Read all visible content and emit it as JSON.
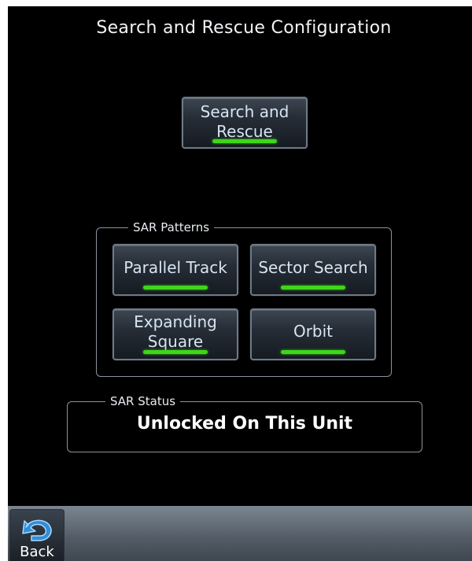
{
  "page": {
    "title": "Search and Rescue Configuration"
  },
  "sar_toggle": {
    "label": "Search and\nRescue",
    "enabled": true
  },
  "patterns": {
    "group_label": "SAR Patterns",
    "items": [
      {
        "label": "Parallel Track",
        "enabled": true
      },
      {
        "label": "Sector Search",
        "enabled": true
      },
      {
        "label": "Expanding\nSquare",
        "enabled": true
      },
      {
        "label": "Orbit",
        "enabled": true
      }
    ]
  },
  "status": {
    "group_label": "SAR Status",
    "value": "Unlocked On This Unit"
  },
  "footer": {
    "back_label": "Back",
    "back_icon": "back-arrow-icon"
  },
  "colors": {
    "background": "#000000",
    "indicator_on": "#3fd61a",
    "button_text": "#d7e4f3",
    "footer_bar": "#5e6771"
  }
}
